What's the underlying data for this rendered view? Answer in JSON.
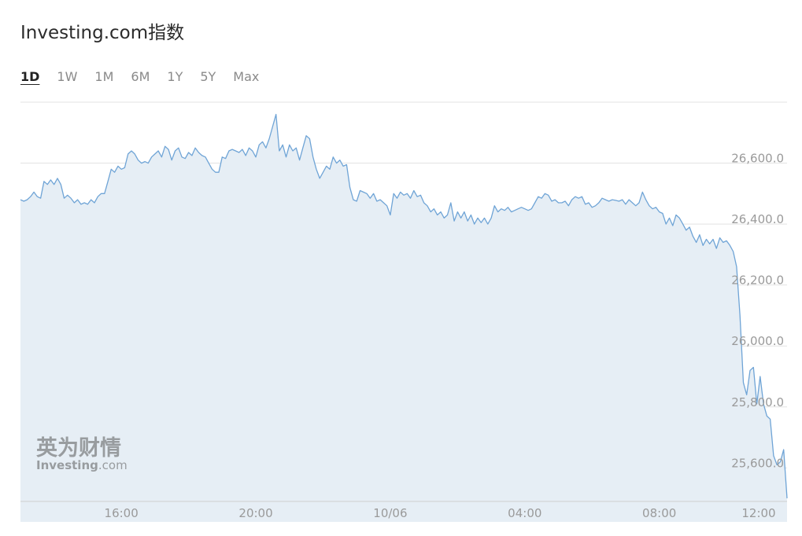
{
  "title": "Investing.com指数",
  "ranges": [
    "1D",
    "1W",
    "1M",
    "6M",
    "1Y",
    "5Y",
    "Max"
  ],
  "active_range": "1D",
  "watermark": {
    "cn": "英为财情",
    "en_main": "Investing",
    "en_suffix": ".com"
  },
  "colors": {
    "line": "#6fa4d6",
    "fill": "#e6eef5",
    "grid": "#e3e3e3",
    "axis_text": "#9a9a9a"
  },
  "chart_data": {
    "type": "area",
    "title": "",
    "xlabel": "",
    "ylabel": "",
    "x_ticks": [
      "16:00",
      "20:00",
      "10/06",
      "04:00",
      "08:00",
      "12:00"
    ],
    "y_ticks": [
      25600.0,
      25800.0,
      26000.0,
      26200.0,
      26400.0,
      26600.0
    ],
    "y_tick_labels": [
      "25,600.0",
      "25,800.0",
      "26,000.0",
      "26,200.0",
      "26,400.0",
      "26,600.0"
    ],
    "ylim": [
      25490,
      26800
    ],
    "x_unit": "hours relative to 16:00 (day 1)",
    "grid": true,
    "series": [
      {
        "values": [
          [
            -3.0,
            26480
          ],
          [
            -2.9,
            26475
          ],
          [
            -2.8,
            26480
          ],
          [
            -2.7,
            26490
          ],
          [
            -2.6,
            26505
          ],
          [
            -2.5,
            26490
          ],
          [
            -2.4,
            26485
          ],
          [
            -2.3,
            26540
          ],
          [
            -2.2,
            26530
          ],
          [
            -2.1,
            26545
          ],
          [
            -2.0,
            26530
          ],
          [
            -1.9,
            26550
          ],
          [
            -1.8,
            26530
          ],
          [
            -1.7,
            26485
          ],
          [
            -1.6,
            26495
          ],
          [
            -1.5,
            26485
          ],
          [
            -1.4,
            26470
          ],
          [
            -1.3,
            26480
          ],
          [
            -1.2,
            26465
          ],
          [
            -1.1,
            26470
          ],
          [
            -1.0,
            26465
          ],
          [
            -0.9,
            26480
          ],
          [
            -0.8,
            26470
          ],
          [
            -0.7,
            26490
          ],
          [
            -0.6,
            26500
          ],
          [
            -0.5,
            26500
          ],
          [
            -0.4,
            26540
          ],
          [
            -0.3,
            26580
          ],
          [
            -0.2,
            26570
          ],
          [
            -0.1,
            26590
          ],
          [
            0.0,
            26580
          ],
          [
            0.1,
            26585
          ],
          [
            0.2,
            26630
          ],
          [
            0.3,
            26640
          ],
          [
            0.4,
            26630
          ],
          [
            0.5,
            26610
          ],
          [
            0.6,
            26600
          ],
          [
            0.7,
            26605
          ],
          [
            0.8,
            26600
          ],
          [
            0.9,
            26620
          ],
          [
            1.0,
            26630
          ],
          [
            1.1,
            26640
          ],
          [
            1.2,
            26620
          ],
          [
            1.3,
            26655
          ],
          [
            1.4,
            26645
          ],
          [
            1.5,
            26610
          ],
          [
            1.6,
            26640
          ],
          [
            1.7,
            26650
          ],
          [
            1.8,
            26620
          ],
          [
            1.9,
            26615
          ],
          [
            2.0,
            26635
          ],
          [
            2.1,
            26625
          ],
          [
            2.2,
            26650
          ],
          [
            2.3,
            26635
          ],
          [
            2.4,
            26625
          ],
          [
            2.5,
            26620
          ],
          [
            2.6,
            26600
          ],
          [
            2.7,
            26580
          ],
          [
            2.8,
            26570
          ],
          [
            2.9,
            26570
          ],
          [
            3.0,
            26620
          ],
          [
            3.1,
            26615
          ],
          [
            3.2,
            26640
          ],
          [
            3.3,
            26645
          ],
          [
            3.4,
            26640
          ],
          [
            3.5,
            26635
          ],
          [
            3.6,
            26645
          ],
          [
            3.7,
            26625
          ],
          [
            3.8,
            26650
          ],
          [
            3.9,
            26640
          ],
          [
            4.0,
            26620
          ],
          [
            4.1,
            26660
          ],
          [
            4.2,
            26670
          ],
          [
            4.3,
            26650
          ],
          [
            4.4,
            26680
          ],
          [
            4.5,
            26720
          ],
          [
            4.6,
            26760
          ],
          [
            4.7,
            26640
          ],
          [
            4.8,
            26660
          ],
          [
            4.9,
            26620
          ],
          [
            5.0,
            26660
          ],
          [
            5.1,
            26640
          ],
          [
            5.2,
            26650
          ],
          [
            5.3,
            26610
          ],
          [
            5.4,
            26650
          ],
          [
            5.5,
            26690
          ],
          [
            5.6,
            26680
          ],
          [
            5.7,
            26620
          ],
          [
            5.8,
            26580
          ],
          [
            5.9,
            26550
          ],
          [
            6.0,
            26570
          ],
          [
            6.1,
            26590
          ],
          [
            6.2,
            26580
          ],
          [
            6.3,
            26620
          ],
          [
            6.4,
            26600
          ],
          [
            6.5,
            26610
          ],
          [
            6.6,
            26590
          ],
          [
            6.7,
            26595
          ],
          [
            6.8,
            26520
          ],
          [
            6.9,
            26480
          ],
          [
            7.0,
            26475
          ],
          [
            7.1,
            26510
          ],
          [
            7.2,
            26505
          ],
          [
            7.3,
            26500
          ],
          [
            7.4,
            26485
          ],
          [
            7.5,
            26500
          ],
          [
            7.6,
            26475
          ],
          [
            7.7,
            26480
          ],
          [
            7.8,
            26470
          ],
          [
            7.9,
            26460
          ],
          [
            8.0,
            26430
          ],
          [
            8.1,
            26500
          ],
          [
            8.2,
            26485
          ],
          [
            8.3,
            26505
          ],
          [
            8.4,
            26495
          ],
          [
            8.5,
            26500
          ],
          [
            8.6,
            26485
          ],
          [
            8.7,
            26510
          ],
          [
            8.8,
            26490
          ],
          [
            8.9,
            26495
          ],
          [
            9.0,
            26470
          ],
          [
            9.1,
            26460
          ],
          [
            9.2,
            26440
          ],
          [
            9.3,
            26450
          ],
          [
            9.4,
            26430
          ],
          [
            9.5,
            26440
          ],
          [
            9.6,
            26420
          ],
          [
            9.7,
            26430
          ],
          [
            9.8,
            26470
          ],
          [
            9.9,
            26410
          ],
          [
            10.0,
            26440
          ],
          [
            10.1,
            26420
          ],
          [
            10.2,
            26440
          ],
          [
            10.3,
            26410
          ],
          [
            10.4,
            26430
          ],
          [
            10.5,
            26400
          ],
          [
            10.6,
            26420
          ],
          [
            10.7,
            26405
          ],
          [
            10.8,
            26420
          ],
          [
            10.9,
            26400
          ],
          [
            11.0,
            26420
          ],
          [
            11.1,
            26460
          ],
          [
            11.2,
            26440
          ],
          [
            11.3,
            26450
          ],
          [
            11.4,
            26445
          ],
          [
            11.5,
            26455
          ],
          [
            11.6,
            26440
          ],
          [
            11.7,
            26445
          ],
          [
            11.8,
            26450
          ],
          [
            11.9,
            26455
          ],
          [
            12.0,
            26450
          ],
          [
            12.1,
            26445
          ],
          [
            12.2,
            26450
          ],
          [
            12.3,
            26470
          ],
          [
            12.4,
            26490
          ],
          [
            12.5,
            26485
          ],
          [
            12.6,
            26500
          ],
          [
            12.7,
            26495
          ],
          [
            12.8,
            26475
          ],
          [
            12.9,
            26480
          ],
          [
            13.0,
            26470
          ],
          [
            13.1,
            26470
          ],
          [
            13.2,
            26475
          ],
          [
            13.3,
            26460
          ],
          [
            13.4,
            26480
          ],
          [
            13.5,
            26490
          ],
          [
            13.6,
            26485
          ],
          [
            13.7,
            26490
          ],
          [
            13.8,
            26465
          ],
          [
            13.9,
            26470
          ],
          [
            14.0,
            26455
          ],
          [
            14.1,
            26460
          ],
          [
            14.2,
            26470
          ],
          [
            14.3,
            26485
          ],
          [
            14.4,
            26480
          ],
          [
            14.5,
            26475
          ],
          [
            14.6,
            26480
          ],
          [
            14.7,
            26478
          ],
          [
            14.8,
            26475
          ],
          [
            14.9,
            26480
          ],
          [
            15.0,
            26465
          ],
          [
            15.1,
            26480
          ],
          [
            15.2,
            26470
          ],
          [
            15.3,
            26460
          ],
          [
            15.4,
            26470
          ],
          [
            15.5,
            26505
          ],
          [
            15.6,
            26480
          ],
          [
            15.7,
            26460
          ],
          [
            15.8,
            26450
          ],
          [
            15.9,
            26455
          ],
          [
            16.0,
            26440
          ],
          [
            16.1,
            26435
          ],
          [
            16.2,
            26400
          ],
          [
            16.3,
            26420
          ],
          [
            16.4,
            26395
          ],
          [
            16.5,
            26430
          ],
          [
            16.6,
            26420
          ],
          [
            16.7,
            26400
          ],
          [
            16.8,
            26380
          ],
          [
            16.9,
            26390
          ],
          [
            17.0,
            26360
          ],
          [
            17.1,
            26340
          ],
          [
            17.2,
            26365
          ],
          [
            17.3,
            26330
          ],
          [
            17.4,
            26350
          ],
          [
            17.5,
            26335
          ],
          [
            17.6,
            26350
          ],
          [
            17.7,
            26320
          ],
          [
            17.8,
            26355
          ],
          [
            17.9,
            26340
          ],
          [
            18.0,
            26345
          ],
          [
            18.1,
            26330
          ],
          [
            18.2,
            26310
          ],
          [
            18.3,
            26260
          ],
          [
            18.4,
            26100
          ],
          [
            18.5,
            25880
          ],
          [
            18.6,
            25840
          ],
          [
            18.7,
            25920
          ],
          [
            18.8,
            25930
          ],
          [
            18.9,
            25810
          ],
          [
            19.0,
            25900
          ],
          [
            19.1,
            25810
          ],
          [
            19.2,
            25770
          ],
          [
            19.3,
            25760
          ],
          [
            19.4,
            25640
          ],
          [
            19.5,
            25610
          ],
          [
            19.6,
            25620
          ],
          [
            19.7,
            25660
          ],
          [
            19.8,
            25500
          ]
        ]
      }
    ]
  }
}
